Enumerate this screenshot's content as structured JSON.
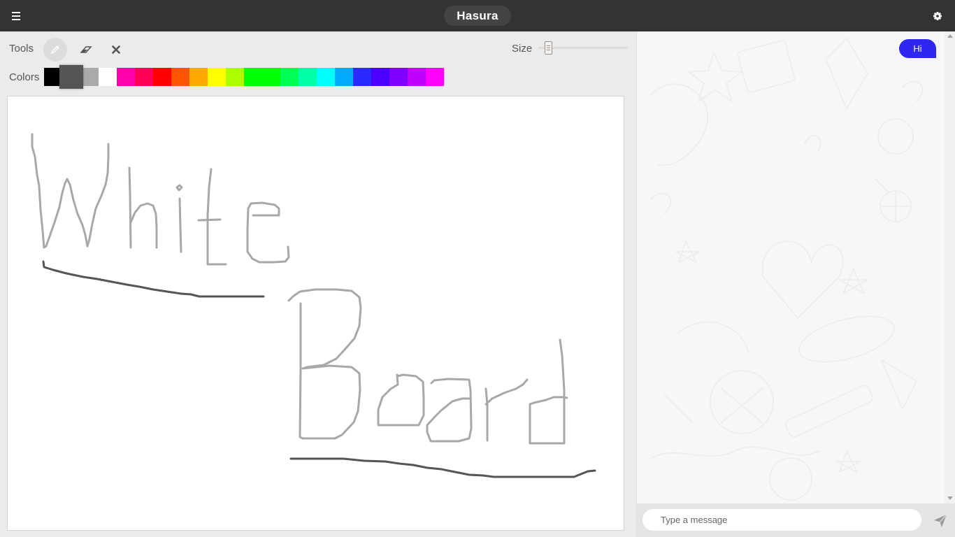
{
  "app": {
    "title": "Hasura"
  },
  "toolbar": {
    "tools_label": "Tools",
    "tools": [
      {
        "name": "pencil",
        "icon": "pencil-icon",
        "active": true
      },
      {
        "name": "eraser",
        "icon": "eraser-icon",
        "active": false
      },
      {
        "name": "clear",
        "icon": "close-icon",
        "active": false
      }
    ],
    "size_label": "Size",
    "size_value_fraction": 0.12,
    "colors_label": "Colors",
    "selected_color": "#555555",
    "palette": [
      "#000000",
      "#555555",
      "#aaaaaa",
      "#ffffff",
      "#ff00aa",
      "#ff0055",
      "#ff0000",
      "#ff5500",
      "#ffaa00",
      "#ffff00",
      "#aaff00",
      "#00ff00",
      "#00ff00",
      "#00ff55",
      "#00ffaa",
      "#00ffff",
      "#00aaff",
      "#2a2aff",
      "#4a00ff",
      "#8000ff",
      "#c000ff",
      "#ff00ff"
    ]
  },
  "canvas": {
    "drawing_strokes_colors": [
      "#aaaaaa",
      "#555555"
    ]
  },
  "chat": {
    "messages": [
      {
        "text": "Hi",
        "from": "me"
      }
    ],
    "input_placeholder": "Type a message",
    "accent_color": "#2d27f0"
  }
}
